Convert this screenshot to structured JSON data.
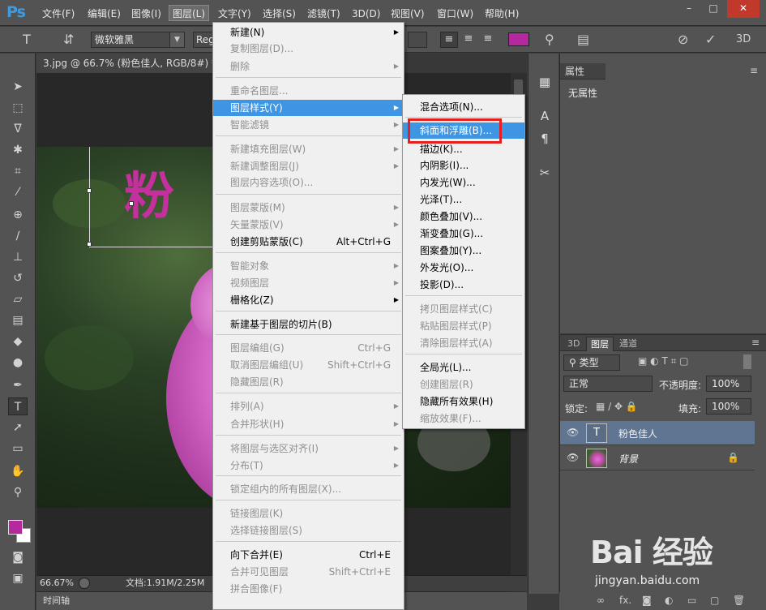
{
  "app": {
    "logo": "Ps"
  },
  "menubar": {
    "items": [
      {
        "label": "文件(F)"
      },
      {
        "label": "编辑(E)"
      },
      {
        "label": "图像(I)"
      },
      {
        "label": "图层(L)"
      },
      {
        "label": "文字(Y)"
      },
      {
        "label": "选择(S)"
      },
      {
        "label": "滤镜(T)"
      },
      {
        "label": "3D(D)"
      },
      {
        "label": "视图(V)"
      },
      {
        "label": "窗口(W)"
      },
      {
        "label": "帮助(H)"
      }
    ],
    "window_buttons": {
      "minimize": "–",
      "maximize": "□",
      "close": "✕"
    }
  },
  "options": {
    "font_family": "微软雅黑",
    "font_style": "Regular",
    "text_color": "#b5289e",
    "three_d": "3D"
  },
  "document": {
    "tab_title": "3.jpg @ 66.7% (粉色佳人, RGB/8#) *",
    "canvas_text": "粉",
    "zoom": "66.67%",
    "doc_size": "文档:1.91M/2.25M",
    "timeline": "时间轴"
  },
  "layer_menu": {
    "items": [
      {
        "label": "新建(N)",
        "disabled": false,
        "arrow": true
      },
      {
        "label": "复制图层(D)...",
        "disabled": true
      },
      {
        "label": "删除",
        "disabled": true,
        "arrow": true
      },
      {
        "label": "重命名图层...",
        "disabled": true
      },
      {
        "label": "图层样式(Y)",
        "disabled": false,
        "arrow": true,
        "highlight": true
      },
      {
        "label": "智能滤镜",
        "disabled": true,
        "arrow": true
      },
      {
        "label": "新建填充图层(W)",
        "disabled": true,
        "arrow": true
      },
      {
        "label": "新建调整图层(J)",
        "disabled": true,
        "arrow": true
      },
      {
        "label": "图层内容选项(O)...",
        "disabled": true
      },
      {
        "label": "图层蒙版(M)",
        "disabled": true,
        "arrow": true
      },
      {
        "label": "矢量蒙版(V)",
        "disabled": true,
        "arrow": true
      },
      {
        "label": "创建剪贴蒙版(C)",
        "disabled": false,
        "shortcut": "Alt+Ctrl+G"
      },
      {
        "label": "智能对象",
        "disabled": true,
        "arrow": true
      },
      {
        "label": "视频图层",
        "disabled": true,
        "arrow": true
      },
      {
        "label": "栅格化(Z)",
        "disabled": false,
        "arrow": true
      },
      {
        "label": "新建基于图层的切片(B)",
        "disabled": false
      },
      {
        "label": "图层编组(G)",
        "disabled": true,
        "shortcut": "Ctrl+G"
      },
      {
        "label": "取消图层编组(U)",
        "disabled": true,
        "shortcut": "Shift+Ctrl+G"
      },
      {
        "label": "隐藏图层(R)",
        "disabled": true
      },
      {
        "label": "排列(A)",
        "disabled": true,
        "arrow": true
      },
      {
        "label": "合并形状(H)",
        "disabled": true,
        "arrow": true
      },
      {
        "label": "将图层与选区对齐(I)",
        "disabled": true,
        "arrow": true
      },
      {
        "label": "分布(T)",
        "disabled": true,
        "arrow": true
      },
      {
        "label": "锁定组内的所有图层(X)...",
        "disabled": true
      },
      {
        "label": "链接图层(K)",
        "disabled": true
      },
      {
        "label": "选择链接图层(S)",
        "disabled": true
      },
      {
        "label": "向下合并(E)",
        "disabled": false,
        "shortcut": "Ctrl+E"
      },
      {
        "label": "合并可见图层",
        "disabled": true,
        "shortcut": "Shift+Ctrl+E"
      },
      {
        "label": "拼合图像(F)",
        "disabled": true
      }
    ]
  },
  "style_menu": {
    "items": [
      {
        "label": "混合选项(N)...",
        "disabled": false
      },
      {
        "label": "斜面和浮雕(B)...",
        "disabled": false,
        "highlight": true
      },
      {
        "label": "描边(K)...",
        "disabled": false
      },
      {
        "label": "内阴影(I)...",
        "disabled": false
      },
      {
        "label": "内发光(W)...",
        "disabled": false
      },
      {
        "label": "光泽(T)...",
        "disabled": false
      },
      {
        "label": "颜色叠加(V)...",
        "disabled": false
      },
      {
        "label": "渐变叠加(G)...",
        "disabled": false
      },
      {
        "label": "图案叠加(Y)...",
        "disabled": false
      },
      {
        "label": "外发光(O)...",
        "disabled": false
      },
      {
        "label": "投影(D)...",
        "disabled": false
      },
      {
        "label": "拷贝图层样式(C)",
        "disabled": true
      },
      {
        "label": "粘贴图层样式(P)",
        "disabled": true
      },
      {
        "label": "清除图层样式(A)",
        "disabled": true
      },
      {
        "label": "全局光(L)...",
        "disabled": false
      },
      {
        "label": "创建图层(R)",
        "disabled": true
      },
      {
        "label": "隐藏所有效果(H)",
        "disabled": false
      },
      {
        "label": "缩放效果(F)...",
        "disabled": true
      }
    ]
  },
  "properties": {
    "title": "属性",
    "empty_text": "无属性"
  },
  "layers_panel": {
    "tabs": [
      "3D",
      "图层",
      "通道"
    ],
    "filter_type": "类型",
    "blend_mode": "正常",
    "opacity_label": "不透明度:",
    "opacity_value": "100%",
    "lock_label": "锁定:",
    "fill_label": "填充:",
    "fill_value": "100%",
    "layers": [
      {
        "name": "粉色佳人",
        "thumb": "T"
      },
      {
        "name": "背景"
      }
    ]
  },
  "watermark": {
    "text": "Bai 经验",
    "sub": "jingyan.baidu.com"
  }
}
